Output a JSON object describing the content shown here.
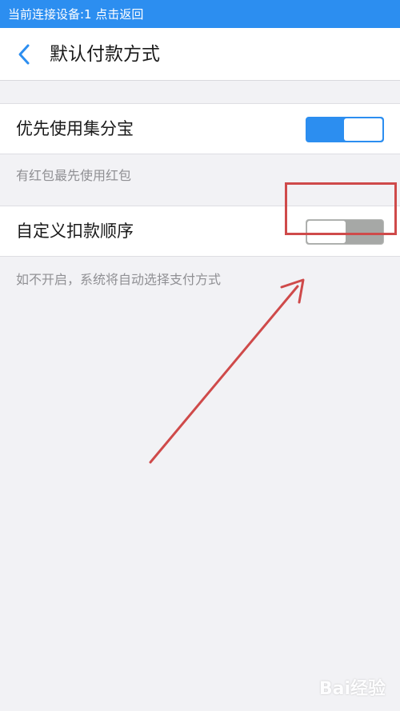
{
  "status_bar": {
    "text": "当前连接设备:1 点击返回"
  },
  "header": {
    "title": "默认付款方式",
    "back_icon": "chevron-left-icon"
  },
  "settings": [
    {
      "label": "优先使用集分宝",
      "enabled": true,
      "hint": "有红包最先使用红包"
    },
    {
      "label": "自定义扣款顺序",
      "enabled": false,
      "hint": "如不开启，系统将自动选择支付方式"
    }
  ],
  "annotation": {
    "color": "#cf4a4a"
  },
  "colors": {
    "accent": "#2c8ef0",
    "toggle_off": "#a6a8a6",
    "background": "#f2f2f5"
  },
  "watermark": {
    "text": "Bai经验"
  }
}
